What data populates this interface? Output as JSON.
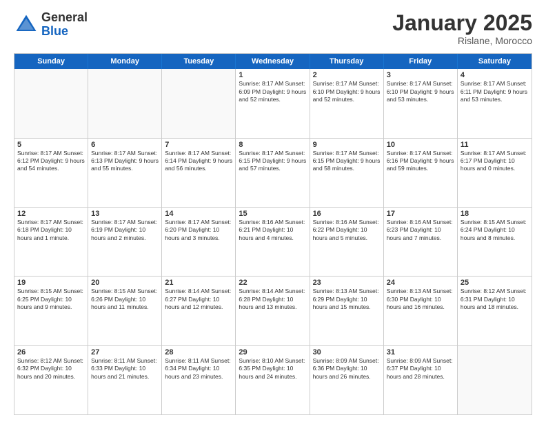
{
  "logo": {
    "general": "General",
    "blue": "Blue"
  },
  "header": {
    "month": "January 2025",
    "location": "Rislane, Morocco"
  },
  "weekdays": [
    "Sunday",
    "Monday",
    "Tuesday",
    "Wednesday",
    "Thursday",
    "Friday",
    "Saturday"
  ],
  "rows": [
    [
      {
        "day": "",
        "info": "",
        "empty": true
      },
      {
        "day": "",
        "info": "",
        "empty": true
      },
      {
        "day": "",
        "info": "",
        "empty": true
      },
      {
        "day": "1",
        "info": "Sunrise: 8:17 AM\nSunset: 6:09 PM\nDaylight: 9 hours and 52 minutes."
      },
      {
        "day": "2",
        "info": "Sunrise: 8:17 AM\nSunset: 6:10 PM\nDaylight: 9 hours and 52 minutes."
      },
      {
        "day": "3",
        "info": "Sunrise: 8:17 AM\nSunset: 6:10 PM\nDaylight: 9 hours and 53 minutes."
      },
      {
        "day": "4",
        "info": "Sunrise: 8:17 AM\nSunset: 6:11 PM\nDaylight: 9 hours and 53 minutes."
      }
    ],
    [
      {
        "day": "5",
        "info": "Sunrise: 8:17 AM\nSunset: 6:12 PM\nDaylight: 9 hours and 54 minutes."
      },
      {
        "day": "6",
        "info": "Sunrise: 8:17 AM\nSunset: 6:13 PM\nDaylight: 9 hours and 55 minutes."
      },
      {
        "day": "7",
        "info": "Sunrise: 8:17 AM\nSunset: 6:14 PM\nDaylight: 9 hours and 56 minutes."
      },
      {
        "day": "8",
        "info": "Sunrise: 8:17 AM\nSunset: 6:15 PM\nDaylight: 9 hours and 57 minutes."
      },
      {
        "day": "9",
        "info": "Sunrise: 8:17 AM\nSunset: 6:15 PM\nDaylight: 9 hours and 58 minutes."
      },
      {
        "day": "10",
        "info": "Sunrise: 8:17 AM\nSunset: 6:16 PM\nDaylight: 9 hours and 59 minutes."
      },
      {
        "day": "11",
        "info": "Sunrise: 8:17 AM\nSunset: 6:17 PM\nDaylight: 10 hours and 0 minutes."
      }
    ],
    [
      {
        "day": "12",
        "info": "Sunrise: 8:17 AM\nSunset: 6:18 PM\nDaylight: 10 hours and 1 minute."
      },
      {
        "day": "13",
        "info": "Sunrise: 8:17 AM\nSunset: 6:19 PM\nDaylight: 10 hours and 2 minutes."
      },
      {
        "day": "14",
        "info": "Sunrise: 8:17 AM\nSunset: 6:20 PM\nDaylight: 10 hours and 3 minutes."
      },
      {
        "day": "15",
        "info": "Sunrise: 8:16 AM\nSunset: 6:21 PM\nDaylight: 10 hours and 4 minutes."
      },
      {
        "day": "16",
        "info": "Sunrise: 8:16 AM\nSunset: 6:22 PM\nDaylight: 10 hours and 5 minutes."
      },
      {
        "day": "17",
        "info": "Sunrise: 8:16 AM\nSunset: 6:23 PM\nDaylight: 10 hours and 7 minutes."
      },
      {
        "day": "18",
        "info": "Sunrise: 8:15 AM\nSunset: 6:24 PM\nDaylight: 10 hours and 8 minutes."
      }
    ],
    [
      {
        "day": "19",
        "info": "Sunrise: 8:15 AM\nSunset: 6:25 PM\nDaylight: 10 hours and 9 minutes."
      },
      {
        "day": "20",
        "info": "Sunrise: 8:15 AM\nSunset: 6:26 PM\nDaylight: 10 hours and 11 minutes."
      },
      {
        "day": "21",
        "info": "Sunrise: 8:14 AM\nSunset: 6:27 PM\nDaylight: 10 hours and 12 minutes."
      },
      {
        "day": "22",
        "info": "Sunrise: 8:14 AM\nSunset: 6:28 PM\nDaylight: 10 hours and 13 minutes."
      },
      {
        "day": "23",
        "info": "Sunrise: 8:13 AM\nSunset: 6:29 PM\nDaylight: 10 hours and 15 minutes."
      },
      {
        "day": "24",
        "info": "Sunrise: 8:13 AM\nSunset: 6:30 PM\nDaylight: 10 hours and 16 minutes."
      },
      {
        "day": "25",
        "info": "Sunrise: 8:12 AM\nSunset: 6:31 PM\nDaylight: 10 hours and 18 minutes."
      }
    ],
    [
      {
        "day": "26",
        "info": "Sunrise: 8:12 AM\nSunset: 6:32 PM\nDaylight: 10 hours and 20 minutes."
      },
      {
        "day": "27",
        "info": "Sunrise: 8:11 AM\nSunset: 6:33 PM\nDaylight: 10 hours and 21 minutes."
      },
      {
        "day": "28",
        "info": "Sunrise: 8:11 AM\nSunset: 6:34 PM\nDaylight: 10 hours and 23 minutes."
      },
      {
        "day": "29",
        "info": "Sunrise: 8:10 AM\nSunset: 6:35 PM\nDaylight: 10 hours and 24 minutes."
      },
      {
        "day": "30",
        "info": "Sunrise: 8:09 AM\nSunset: 6:36 PM\nDaylight: 10 hours and 26 minutes."
      },
      {
        "day": "31",
        "info": "Sunrise: 8:09 AM\nSunset: 6:37 PM\nDaylight: 10 hours and 28 minutes."
      },
      {
        "day": "",
        "info": "",
        "empty": true
      }
    ]
  ]
}
